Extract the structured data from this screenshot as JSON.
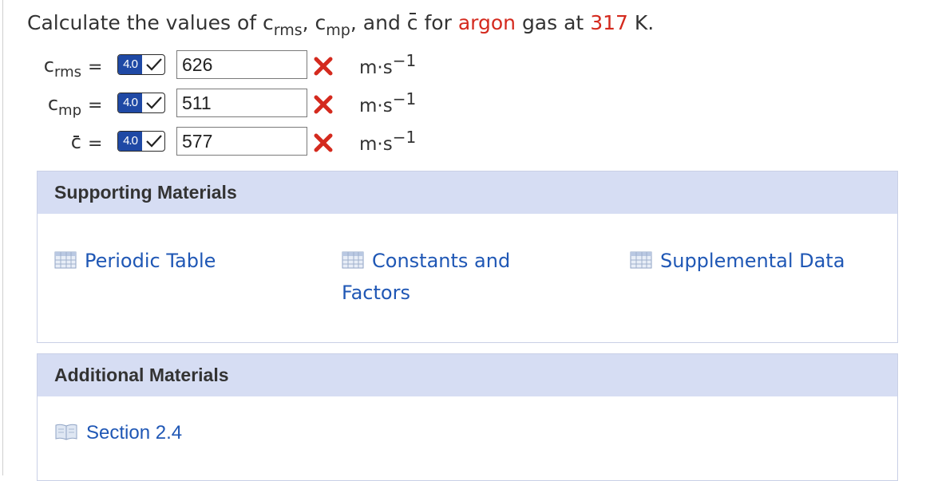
{
  "question": {
    "prefix": "Calculate the values of",
    "c": "c",
    "rms": "rms",
    "mp": "mp",
    "comma": ",",
    "and": "and",
    "for": "for",
    "gas": "argon",
    "mid": "gas at",
    "temp": "317",
    "unit": "K."
  },
  "answers": [
    {
      "var": "c",
      "sub": "rms",
      "eq": "=",
      "badge": "4.0",
      "value": "626",
      "unit": "m·s",
      "exp": "−1"
    },
    {
      "var": "c",
      "sub": "mp",
      "eq": "=",
      "badge": "4.0",
      "value": "511",
      "unit": "m·s",
      "exp": "−1"
    },
    {
      "var": "c",
      "sub": "",
      "eq": "=",
      "badge": "4.0",
      "value": "577",
      "unit": "m·s",
      "exp": "−1"
    }
  ],
  "supporting": {
    "title": "Supporting Materials",
    "items": [
      "Periodic Table",
      "Constants and Factors",
      "Supplemental Data"
    ]
  },
  "additional": {
    "title": "Additional Materials",
    "items": [
      "Section 2.4"
    ]
  },
  "colors": {
    "accent_red": "#d42a1e",
    "link_blue": "#1f57b5",
    "badge_blue": "#1f49a5",
    "panel_header": "#d6ddf3"
  },
  "icons": {
    "result": "red-x-icon",
    "badge": "checkmark-icon",
    "table": "table-icon",
    "book": "book-icon"
  }
}
